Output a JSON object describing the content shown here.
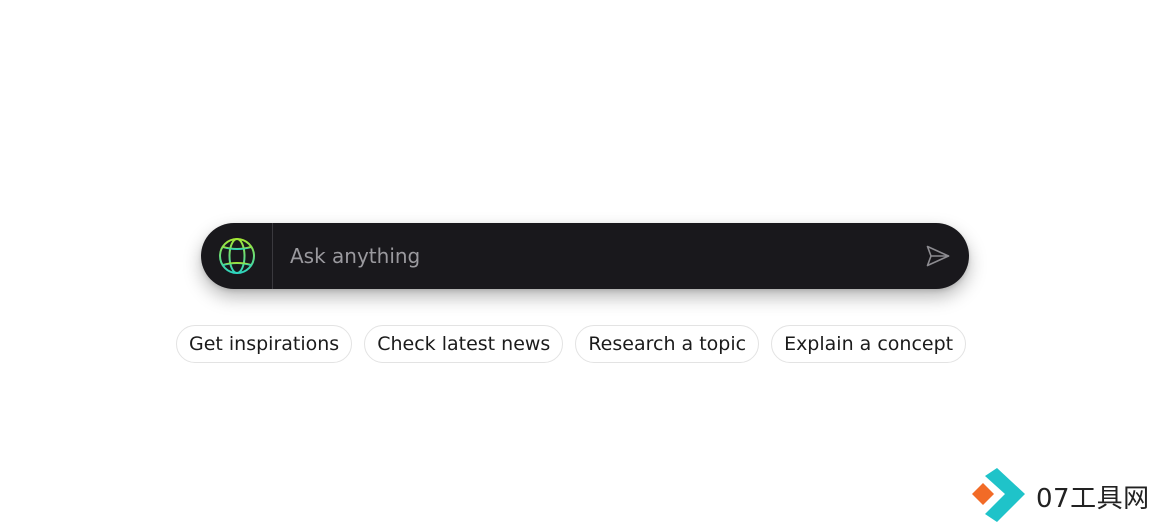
{
  "search": {
    "placeholder": "Ask anything",
    "value": ""
  },
  "chips": [
    {
      "label": "Get inspirations"
    },
    {
      "label": "Check latest news"
    },
    {
      "label": "Research a topic"
    },
    {
      "label": "Explain a concept"
    }
  ],
  "watermark": {
    "text": "07工具网"
  },
  "icons": {
    "left": "globe-icon",
    "right": "send-icon"
  },
  "colors": {
    "bar_background": "#19181c",
    "globe_gradient_start": "#a3e635",
    "globe_gradient_end": "#2dd4bf",
    "chip_border": "#e3e3e3",
    "watermark_orange": "#f26b27",
    "watermark_teal": "#1fc3c9"
  }
}
